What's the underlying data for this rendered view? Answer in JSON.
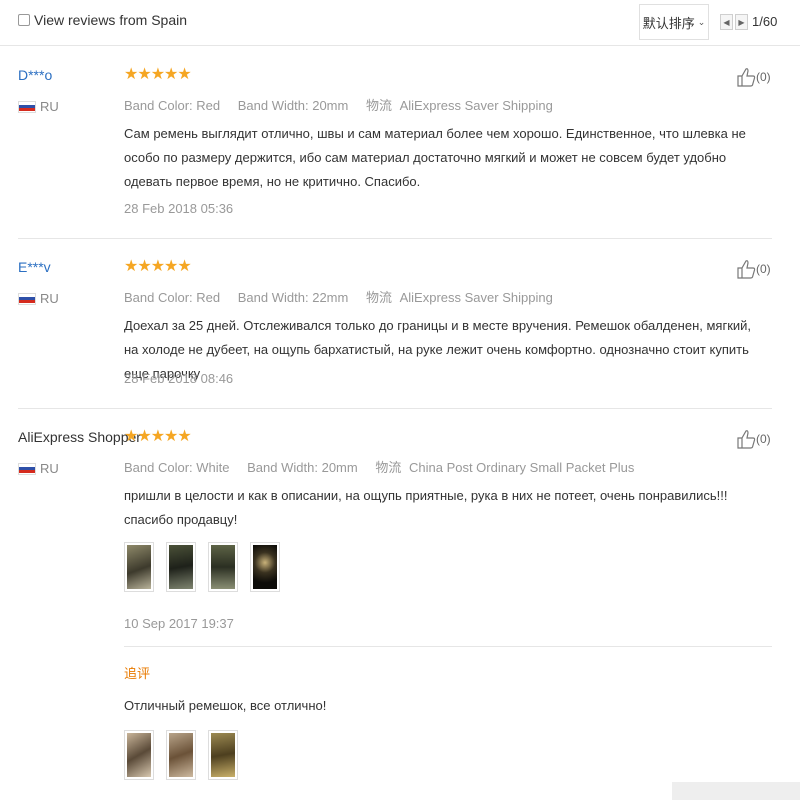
{
  "topbar": {
    "view_reviews_label": "View reviews from Spain",
    "sort_label": "默认排序",
    "page_indicator": "1/60"
  },
  "reviews": [
    {
      "user": "D***o",
      "country": "RU",
      "stars": "★★★★★",
      "color_label": "Band Color:",
      "color_value": "Red",
      "width_label": "Band Width:",
      "width_value": "20mm",
      "shipping_label": "物流",
      "shipping_value": "AliExpress Saver Shipping",
      "text": "Сам ремень выглядит отлично, швы и сам материал более чем хорошо. Единственное, что шлевка не особо по размеру держится, ибо сам материал достаточно мягкий и может не совсем будет удобно одевать первое время, но не критично. Спасибо.",
      "date": "28 Feb 2018 05:36",
      "likes": "(0)"
    },
    {
      "user": "E***v",
      "country": "RU",
      "stars": "★★★★★",
      "color_label": "Band Color:",
      "color_value": "Red",
      "width_label": "Band Width:",
      "width_value": "22mm",
      "shipping_label": "物流",
      "shipping_value": "AliExpress Saver Shipping",
      "text": "Доехал за 25 дней. Отслеживался только до границы и в месте вручения. Ремешок обалденен, мягкий, на холоде не дубеет, на ощупь бархатистый, на руке лежит очень комфортно. однозначно стоит купить еще парочку",
      "date": "28 Feb 2018 08:46",
      "likes": "(0)"
    },
    {
      "user": "AliExpress Shopper",
      "country": "RU",
      "stars": "★★★★★",
      "color_label": "Band Color:",
      "color_value": "White",
      "width_label": "Band Width:",
      "width_value": "20mm",
      "shipping_label": "物流",
      "shipping_value": "China Post Ordinary Small Packet Plus",
      "text": "пришли в целости и как в описании, на ощупь приятные, рука в них не потеет, очень понравились!!! спасибо продавцу!",
      "date": "10 Sep 2017 19:37",
      "likes": "(0)",
      "followup_label": "追评",
      "followup_text": "Отличный ремешок, все отлично!"
    }
  ],
  "colors": {
    "star": "#f5a623",
    "username_link": "#2b6fc2",
    "followup": "#e87a00"
  },
  "icons": {
    "like": "thumbs-up-icon",
    "prev": "caret-left-icon",
    "next": "caret-right-icon",
    "sort": "chevron-down-icon"
  }
}
